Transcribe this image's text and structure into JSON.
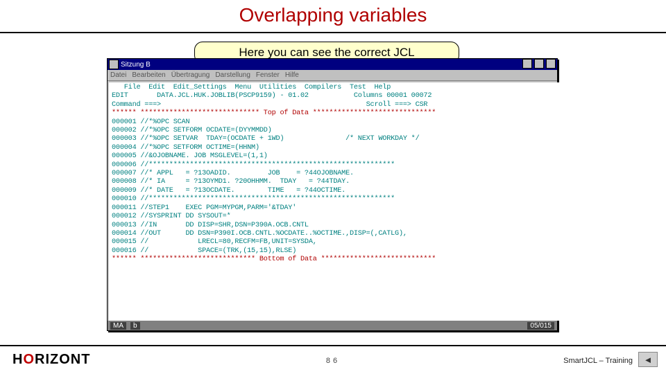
{
  "title": "Overlapping variables",
  "callout": "Here you can see the correct JCL",
  "window": {
    "title": "Sitzung B",
    "menus": [
      "Datei",
      "Bearbeiten",
      "Übertragung",
      "Darstellung",
      "Fenster",
      "Hilfe"
    ],
    "status": {
      "left1": "MA",
      "left2": "b",
      "right": "05/015"
    }
  },
  "term": {
    "l0": "   File  Edit  Edit_Settings  Menu  Utilities  Compilers  Test  Help",
    "l1": "EDIT       DATA.JCL.HUK.JOBLIB(PSCP9159) - 01.02           Columns 00001 00072",
    "l2": "Command ===>                                                  Scroll ===> CSR",
    "l3": "****** ***************************** Top of Data ******************************",
    "l4": "000001 //*%OPC SCAN",
    "l5": "000002 //*%OPC SETFORM OCDATE=(DYYMMDD)",
    "l6": "000003 //*%OPC SETVAR  TDAY=(OCDATE + 1WD)               /* NEXT WORKDAY */",
    "l7": "000004 //*%OPC SETFORM OCTIME=(HHNM)",
    "l8": "000005 //&OJOBNAME. JOB MSGLEVEL=(1,1)",
    "l9": "000006 //************************************************************",
    "l10": "000007 //* APPL   = ?13OADID.         JOB    = ?44OJOBNAME.",
    "l11": "000008 //* IA     = ?13OYMD1. ?20OHHMM.  TDAY   = ?44TDAY.",
    "l12": "000009 //* DATE   = ?13OCDATE.        TIME   = ?44OCTIME.",
    "l13": "000010 //************************************************************",
    "l14": "000011 //STEP1    EXEC PGM=MYPGM,PARM='&TDAY'",
    "l15": "000012 //SYSPRINT DD SYSOUT=*",
    "l16": "000013 //IN       DD DISP=SHR,DSN=P390A.OCB.CNTL",
    "l17": "000014 //OUT      DD DSN=P390I.OCB.CNTL.%OCDATE..%OCTIME.,DISP=(,CATLG),",
    "l18": "000015 //            LRECL=80,RECFM=FB,UNIT=SYSDA,",
    "l19": "000016 //            SPACE=(TRK,(15,15),RLSE)",
    "l20": "****** **************************** Bottom of Data ****************************"
  },
  "footer": {
    "page": "86",
    "label": "SmartJCL – Training"
  }
}
